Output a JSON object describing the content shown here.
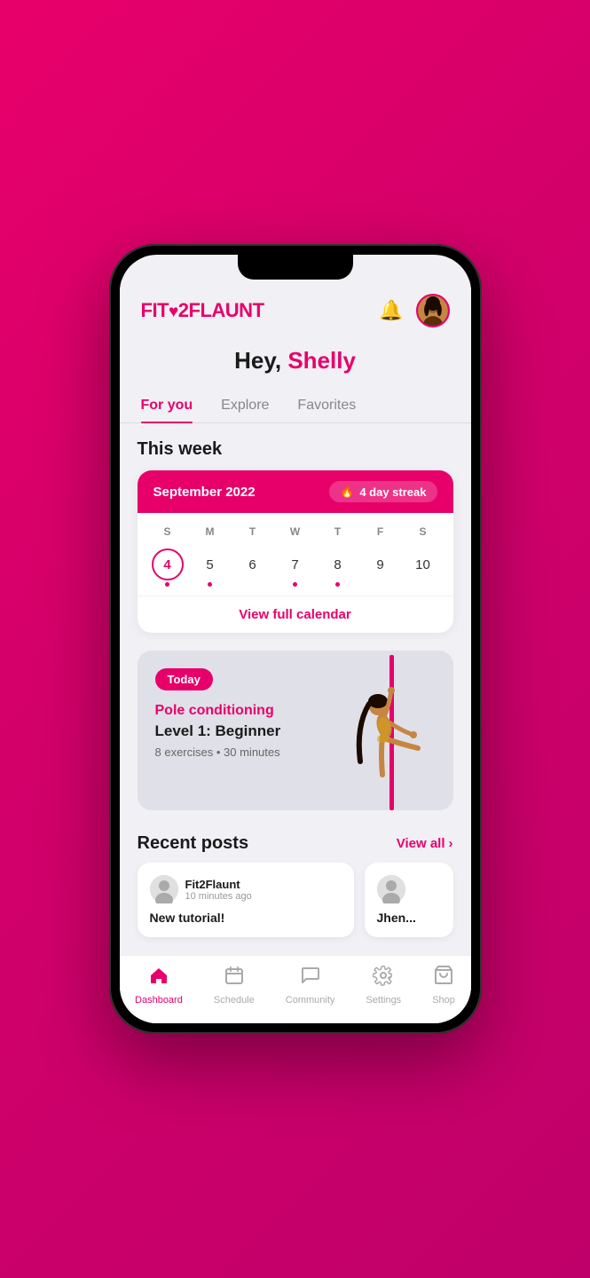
{
  "header": {
    "logo_text": "FIT",
    "logo_number": "2",
    "logo_suffix": "FLAUNT",
    "bell_label": "notifications",
    "avatar_label": "user avatar"
  },
  "greeting": {
    "prefix": "Hey, ",
    "name": "Shelly"
  },
  "tabs": {
    "items": [
      {
        "label": "For you",
        "active": true
      },
      {
        "label": "Explore",
        "active": false
      },
      {
        "label": "Favorites",
        "active": false
      }
    ]
  },
  "this_week": {
    "title": "This week",
    "calendar": {
      "month": "September 2022",
      "streak_label": "4 day streak",
      "day_headers": [
        "S",
        "M",
        "T",
        "W",
        "T",
        "F",
        "S"
      ],
      "days": [
        {
          "num": "4",
          "today": true,
          "dot": true
        },
        {
          "num": "5",
          "today": false,
          "dot": true
        },
        {
          "num": "6",
          "today": false,
          "dot": false
        },
        {
          "num": "7",
          "today": false,
          "dot": true
        },
        {
          "num": "8",
          "today": false,
          "dot": true
        },
        {
          "num": "9",
          "today": false,
          "dot": false
        },
        {
          "num": "10",
          "today": false,
          "dot": false
        }
      ],
      "view_full_label": "View full calendar"
    }
  },
  "today_workout": {
    "badge": "Today",
    "type": "Pole conditioning",
    "name": "Level 1: Beginner",
    "meta": "8 exercises • 30 minutes"
  },
  "recent_posts": {
    "title": "Recent posts",
    "view_all": "View all",
    "posts": [
      {
        "author": "Fit2Flaunt",
        "time": "10 minutes ago",
        "text": "New tutorial!"
      },
      {
        "author": "Jhen...",
        "time": "...",
        "text": ""
      }
    ]
  },
  "bottom_nav": {
    "items": [
      {
        "icon": "🏠",
        "label": "Dashboard",
        "active": true
      },
      {
        "icon": "📅",
        "label": "Schedule",
        "active": false
      },
      {
        "icon": "💬",
        "label": "Community",
        "active": false
      },
      {
        "icon": "⚙️",
        "label": "Settings",
        "active": false
      },
      {
        "icon": "🛒",
        "label": "Shop",
        "active": false
      }
    ]
  }
}
